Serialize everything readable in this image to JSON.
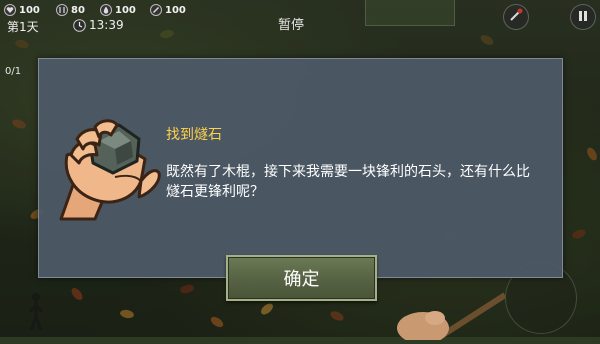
{
  "hud": {
    "stats": [
      {
        "icon": "health-icon",
        "value": "100"
      },
      {
        "icon": "hunger-icon",
        "value": "80"
      },
      {
        "icon": "thirst-icon",
        "value": "100"
      },
      {
        "icon": "energy-icon",
        "value": "100"
      }
    ],
    "day": "第1天",
    "time": "13:39",
    "pause_label": "暂停",
    "inventory_count": "0/1"
  },
  "dialog": {
    "title": "找到燧石",
    "body": "既然有了木棍，接下来我需要一块锋利的石头，还有什么比燧石更锋利呢？",
    "confirm_label": "确定",
    "image": "hand-holding-flint-icon"
  },
  "colors": {
    "title": "#ffd24a",
    "dialog_bg": "#4e5a68",
    "button_bg": "#566243"
  }
}
